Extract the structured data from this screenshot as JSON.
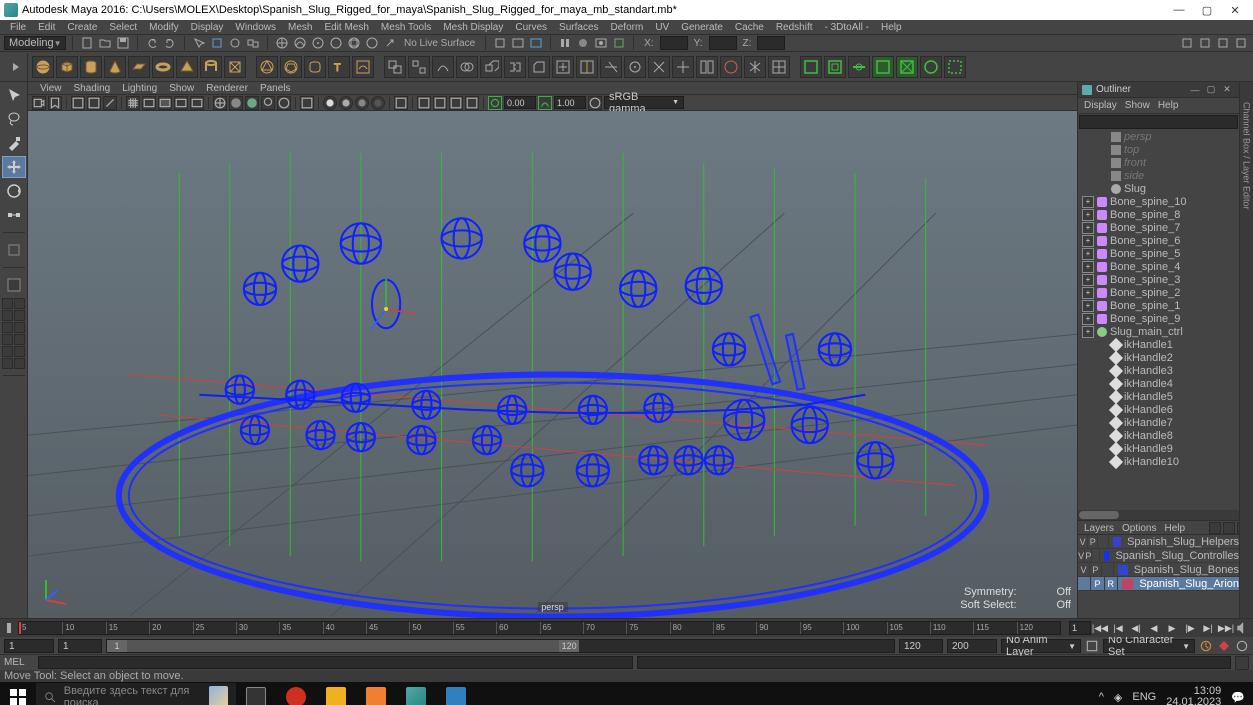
{
  "window": {
    "title": "Autodesk Maya 2016: C:\\Users\\MOLEX\\Desktop\\Spanish_Slug_Rigged_for_maya\\Spanish_Slug_Rigged_for_maya_mb_standart.mb*"
  },
  "main_menu": [
    "File",
    "Edit",
    "Create",
    "Select",
    "Modify",
    "Display",
    "Windows",
    "Mesh",
    "Edit Mesh",
    "Mesh Tools",
    "Mesh Display",
    "Curves",
    "Surfaces",
    "Deform",
    "UV",
    "Generate",
    "Cache",
    "Redshift",
    "- 3DtoAll -",
    "Help"
  ],
  "status_line": {
    "mode": "Modeling",
    "no_live": "No Live Surface",
    "axes": {
      "x": "X:",
      "y": "Y:",
      "z": "Z:"
    }
  },
  "viewport_menu": [
    "View",
    "Shading",
    "Lighting",
    "Show",
    "Renderer",
    "Panels"
  ],
  "viewport_toolbar": {
    "exposure": "0.00",
    "gamma": "1.00",
    "color_space": "sRGB gamma"
  },
  "viewport": {
    "camera": "persp",
    "symmetry_label": "Symmetry:",
    "symmetry_value": "Off",
    "softsel_label": "Soft Select:",
    "softsel_value": "Off"
  },
  "outliner": {
    "title": "Outliner",
    "menu": [
      "Display",
      "Show",
      "Help"
    ],
    "nodes": [
      {
        "name": "persp",
        "icon": "cam",
        "hidden": true,
        "indent": 18
      },
      {
        "name": "top",
        "icon": "cam",
        "hidden": true,
        "indent": 18
      },
      {
        "name": "front",
        "icon": "cam",
        "hidden": true,
        "indent": 18
      },
      {
        "name": "side",
        "icon": "cam",
        "hidden": true,
        "indent": 18
      },
      {
        "name": "Slug",
        "icon": "slug",
        "indent": 18
      },
      {
        "name": "Bone_spine_10",
        "icon": "bone",
        "exp": true,
        "indent": 4
      },
      {
        "name": "Bone_spine_8",
        "icon": "bone",
        "exp": true,
        "indent": 4
      },
      {
        "name": "Bone_spine_7",
        "icon": "bone",
        "exp": true,
        "indent": 4
      },
      {
        "name": "Bone_spine_6",
        "icon": "bone",
        "exp": true,
        "indent": 4
      },
      {
        "name": "Bone_spine_5",
        "icon": "bone",
        "exp": true,
        "indent": 4
      },
      {
        "name": "Bone_spine_4",
        "icon": "bone",
        "exp": true,
        "indent": 4
      },
      {
        "name": "Bone_spine_3",
        "icon": "bone",
        "exp": true,
        "indent": 4
      },
      {
        "name": "Bone_spine_2",
        "icon": "bone",
        "exp": true,
        "indent": 4
      },
      {
        "name": "Bone_spine_1",
        "icon": "bone",
        "exp": true,
        "indent": 4
      },
      {
        "name": "Bone_spine_9",
        "icon": "bone",
        "exp": true,
        "indent": 4
      },
      {
        "name": "Slug_main_ctrl",
        "icon": "ctrl",
        "exp": true,
        "indent": 4
      },
      {
        "name": "ikHandle1",
        "icon": "ik",
        "indent": 18
      },
      {
        "name": "ikHandle2",
        "icon": "ik",
        "indent": 18
      },
      {
        "name": "ikHandle3",
        "icon": "ik",
        "indent": 18
      },
      {
        "name": "ikHandle4",
        "icon": "ik",
        "indent": 18
      },
      {
        "name": "ikHandle5",
        "icon": "ik",
        "indent": 18
      },
      {
        "name": "ikHandle6",
        "icon": "ik",
        "indent": 18
      },
      {
        "name": "ikHandle7",
        "icon": "ik",
        "indent": 18
      },
      {
        "name": "ikHandle8",
        "icon": "ik",
        "indent": 18
      },
      {
        "name": "ikHandle9",
        "icon": "ik",
        "indent": 18
      },
      {
        "name": "ikHandle10",
        "icon": "ik",
        "indent": 18
      }
    ]
  },
  "side_tab": "Channel Box / Layer Editor",
  "layers": {
    "menu": [
      "Layers",
      "Options",
      "Help"
    ],
    "rows": [
      {
        "vis": "V",
        "play": "P",
        "type": "",
        "color": "#3344cc",
        "name": "Spanish_Slug_Helpers"
      },
      {
        "vis": "V",
        "play": "P",
        "type": "",
        "color": "#1030ff",
        "name": "Spanish_Slug_Controlles"
      },
      {
        "vis": "V",
        "play": "P",
        "type": "",
        "color": "#3344cc",
        "name": "Spanish_Slug_Bones"
      },
      {
        "vis": "",
        "play": "P",
        "type": "R",
        "color": "#c84060",
        "name": "Spanish_Slug_Arion",
        "selected": true
      }
    ]
  },
  "time": {
    "ticks": [
      "5",
      "10",
      "15",
      "20",
      "25",
      "30",
      "35",
      "40",
      "45",
      "50",
      "55",
      "60",
      "65",
      "70",
      "75",
      "80",
      "85",
      "90",
      "95",
      "100",
      "105",
      "110",
      "115",
      "120"
    ],
    "current": "1",
    "range_start": "1",
    "range_slider_start": "1",
    "range_slider_end": "120",
    "range_end": "120",
    "range_max": "200",
    "anim_layer": "No Anim Layer",
    "char_set": "No Character Set"
  },
  "cmd": {
    "lang": "MEL"
  },
  "help": "Move Tool: Select an object to move.",
  "taskbar": {
    "search_placeholder": "Введите здесь текст для поиска",
    "lang": "ENG",
    "time": "13:09",
    "date": "24.01.2023"
  }
}
